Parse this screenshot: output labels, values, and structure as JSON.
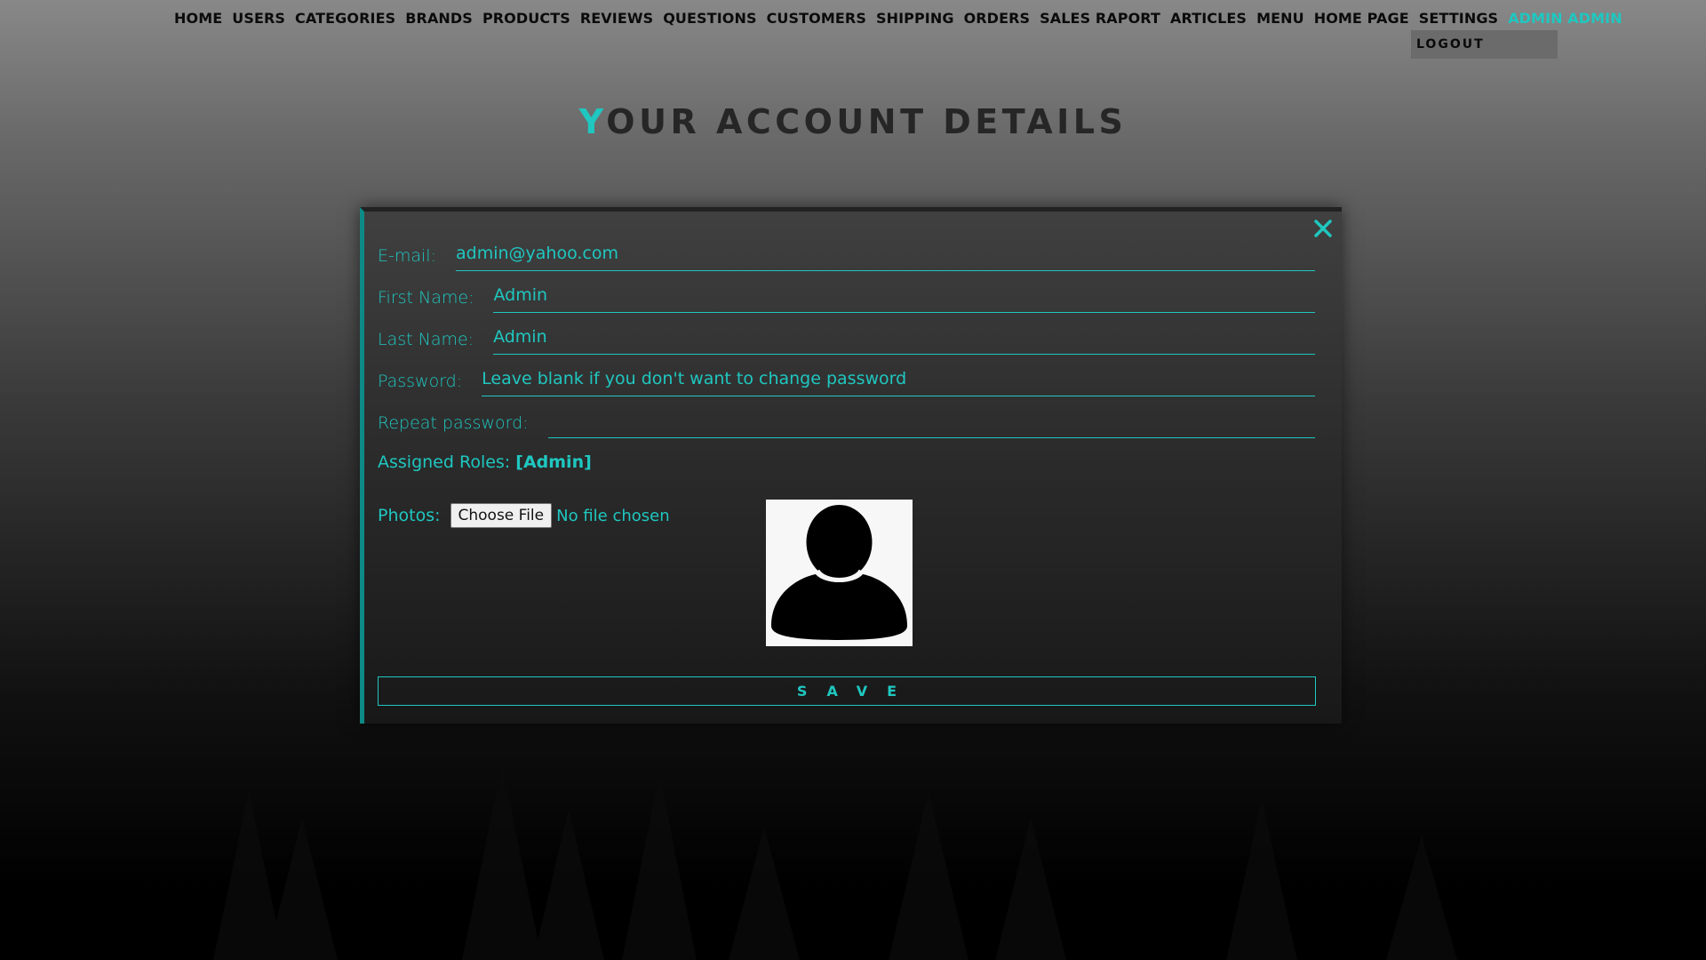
{
  "nav": {
    "items": [
      "HOME",
      "USERS",
      "CATEGORIES",
      "BRANDS",
      "PRODUCTS",
      "REVIEWS",
      "QUESTIONS",
      "CUSTOMERS",
      "SHIPPING",
      "ORDERS",
      "SALES RAPORT",
      "ARTICLES",
      "MENU",
      "HOME PAGE",
      "SETTINGS"
    ],
    "user_name": "ADMIN ADMIN",
    "logout_label": "LOGOUT"
  },
  "page": {
    "title_first_letter": "Y",
    "title_rest": "OUR ACCOUNT DETAILS"
  },
  "form": {
    "email_label": "E-mail:",
    "email_value": "admin@yahoo.com",
    "first_name_label": "First Name:",
    "first_name_value": "Admin",
    "last_name_label": "Last Name:",
    "last_name_value": "Admin",
    "password_label": "Password:",
    "password_placeholder": "Leave blank if you don't want to change password",
    "repeat_password_label": "Repeat password:",
    "repeat_password_value": "",
    "roles_label": "Assigned Roles:",
    "roles_value": "[Admin]",
    "photos_label": "Photos:",
    "choose_file_label": "Choose File",
    "no_file_text": "No file chosen",
    "save_label": "SAVE",
    "close_icon": "close-icon",
    "avatar_icon": "user-silhouette-icon"
  },
  "colors": {
    "accent": "#1fc7c0",
    "panel_border": "#0d8a86",
    "nav_text": "#0b0b0b",
    "logout_bg": "#6b6b6b"
  }
}
